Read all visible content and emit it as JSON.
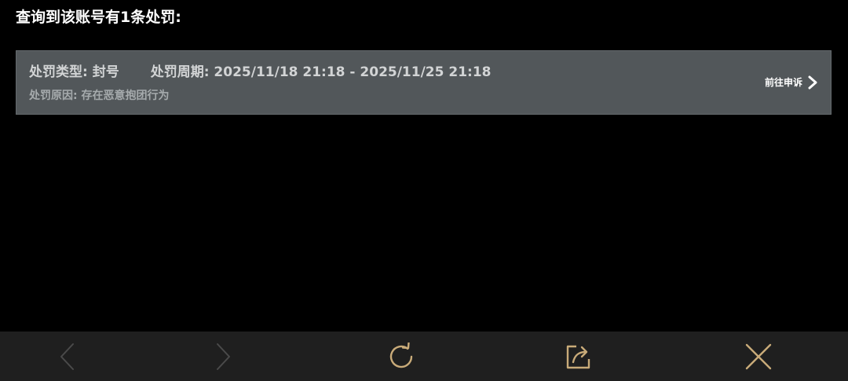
{
  "header": {
    "title": "查询到该账号有1条处罚:"
  },
  "penalty": {
    "type_label": "处罚类型: 封号",
    "period_label": "处罚周期: 2025/11/18 21:18 - 2025/11/25 21:18",
    "reason_label": "处罚原因: 存在恶意抱团行为",
    "appeal_label": "前往申诉"
  },
  "toolbar": {
    "icons": [
      "back-icon",
      "forward-icon",
      "refresh-icon",
      "share-icon",
      "close-icon"
    ],
    "disabled_color": "#4a4a4a",
    "active_color": "#c9ab79"
  },
  "colors": {
    "card_bg": "#52575a",
    "bottom_bar_bg": "#1f1f1f"
  }
}
